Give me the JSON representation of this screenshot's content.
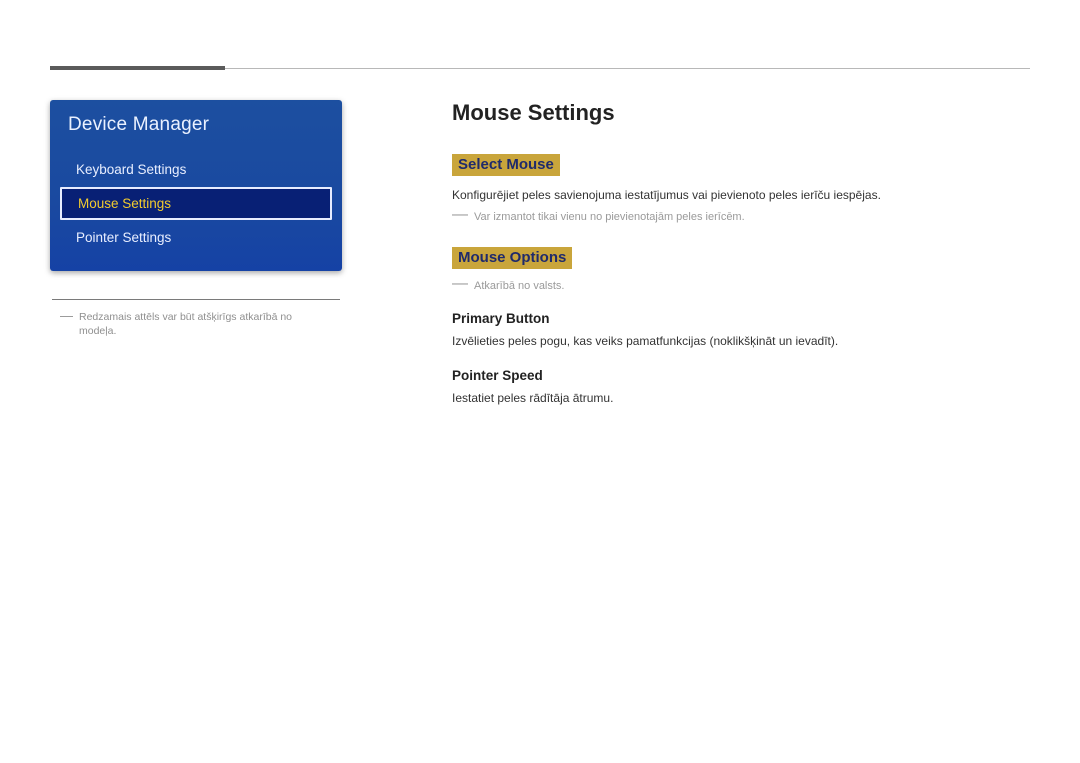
{
  "sidebar": {
    "title": "Device Manager",
    "items": [
      {
        "label": "Keyboard Settings",
        "selected": false
      },
      {
        "label": "Mouse Settings",
        "selected": true
      },
      {
        "label": "Pointer Settings",
        "selected": false
      }
    ],
    "footnote": "Redzamais attēls var būt atšķirīgs atkarībā no modeļa."
  },
  "main": {
    "title": "Mouse Settings",
    "sections": [
      {
        "heading": "Select Mouse",
        "body": "Konfigurējiet peles savienojuma iestatījumus vai pievienoto peles ierīču iespējas.",
        "note": "Var izmantot tikai vienu no pievienotajām peles ierīcēm."
      },
      {
        "heading": "Mouse Options",
        "note": "Atkarībā no valsts.",
        "subsections": [
          {
            "title": "Primary Button",
            "body": "Izvēlieties peles pogu, kas veiks pamatfunkcijas (noklikšķināt un ievadīt)."
          },
          {
            "title": "Pointer Speed",
            "body": "Iestatiet peles rādītāja ātrumu."
          }
        ]
      }
    ]
  }
}
